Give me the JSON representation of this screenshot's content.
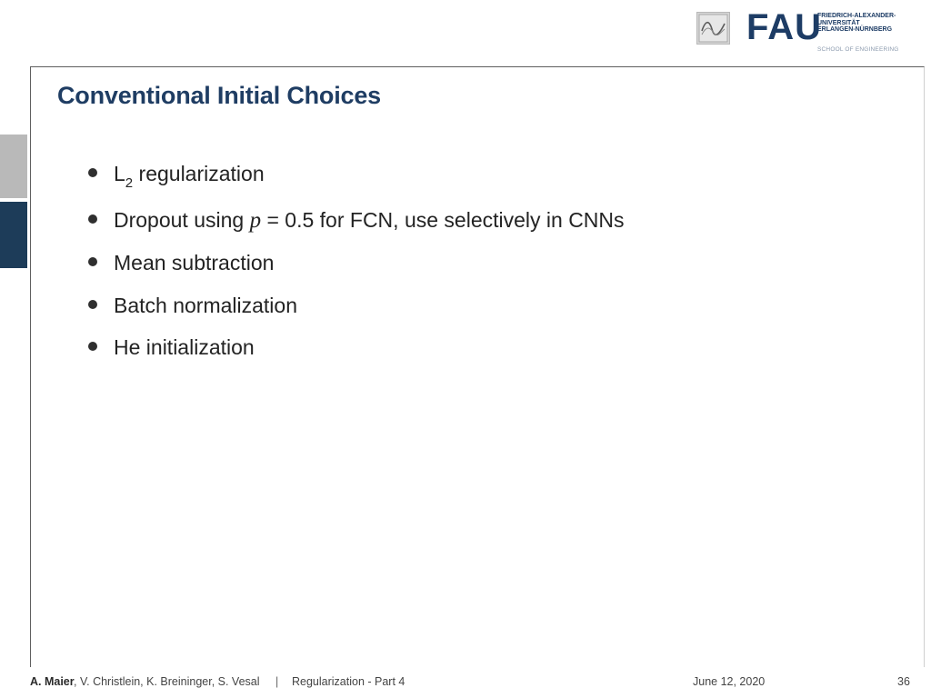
{
  "logo": {
    "name_lines": [
      "FRIEDRICH-ALEXANDER-",
      "UNIVERSITÄT",
      "ERLANGEN-NÜRNBERG"
    ],
    "wordmark": "FAU",
    "school": "SCHOOL OF ENGINEERING",
    "pattern_icon": "pattern-recognition-lab-icon",
    "brand_color": "#1d3c65"
  },
  "slide": {
    "title": "Conventional Initial Choices",
    "title_color": "#1f3d63",
    "bullets": [
      {
        "pre": "L",
        "sub": "2",
        "post": " regularization"
      },
      {
        "pre": "Dropout using ",
        "math_var": "p",
        "math_eq": " = 0.5",
        "post": " for FCN, use selectively in CNNs"
      },
      {
        "text": "Mean subtraction"
      },
      {
        "text": "Batch normalization"
      },
      {
        "text": "He initialization"
      }
    ]
  },
  "footer": {
    "lead_author": "A. Maier",
    "other_authors": ", V. Christlein, K. Breininger, S. Vesal",
    "separator": "|",
    "lecture": "Regularization - Part 4",
    "date": "June 12, 2020",
    "page": "36"
  },
  "colors": {
    "side_block_top": "#b9b9b9",
    "side_block_bottom": "#1d3c59"
  }
}
